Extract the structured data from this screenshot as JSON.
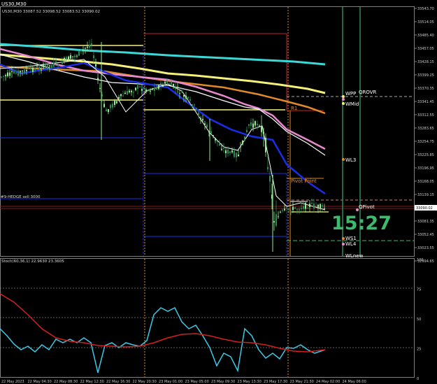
{
  "window": {
    "title": "US30,M30"
  },
  "main_panel": {
    "header": "US30,M30  33087.52 33098.52 33083.52 33090.02",
    "price_axis": [
      "33543.70",
      "33514.05",
      "33485.40",
      "33457.05",
      "33428.15",
      "33399.25",
      "33370.35",
      "33341.45",
      "33312.55",
      "33283.65",
      "33254.75",
      "33225.85",
      "33196.95",
      "33168.05",
      "33139.15",
      "33110.25",
      "33090.02",
      "33081.35",
      "33052.45",
      "33023.55",
      "32994.65"
    ],
    "current_price": "33090.02",
    "left_label": "#9-HEDGE sell 3000",
    "clock": "15:27",
    "level_labels": {
      "wpp": "WPP",
      "qrovr": "QROVR",
      "wmid": "WMid",
      "r1": "R1",
      "pivot_point": "Pivot Point",
      "wl3": "WL3",
      "qpivot": "QPivot",
      "ws1": "WS1",
      "wl4": "WL4",
      "wlnew": "WLnew"
    }
  },
  "oscillator_panel": {
    "header": "Stoch(60,36,1) 22.9630 23.3605",
    "axis": [
      "100",
      "75",
      "50",
      "25",
      "0"
    ]
  },
  "time_axis": [
    "22 May 2023",
    "22 May 04:30",
    "22 May 08:30",
    "22 May 12:30",
    "22 May 16:30",
    "22 May 20:30",
    "23 May 01:00",
    "23 May 05:00",
    "23 May 09:30",
    "23 May 13:30",
    "23 May 17:30",
    "23 May 21:30",
    "24 May 02:00",
    "24 May 06:00"
  ],
  "colors": {
    "background": "#000000",
    "bull_candle": "#90ee90",
    "bear_candle": "#2e8b57",
    "cyan_ma": "#3cd8d8",
    "yellow_ma": "#f5f07a",
    "orange_ma": "#e08a2a",
    "pink_ma": "#e88ad0",
    "white_ma": "#ffffff",
    "blue_ma": "#1a2ee8",
    "stoch_main": "#40c8e8",
    "stoch_signal": "#d02020",
    "clock": "#3dbb6b"
  }
}
